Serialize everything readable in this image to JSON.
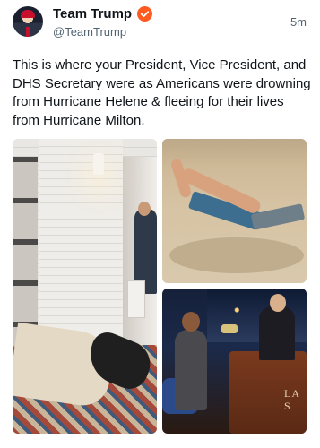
{
  "author": {
    "display_name": "Team Trump",
    "handle": "@TeamTrump",
    "verified_badge_color": "#ff5a1f"
  },
  "post": {
    "time_ago": "5m",
    "text": "This is where your President, Vice President, and DHS Secretary were as Americans were drowning from Hurricane Helene & fleeing for their lives from Hurricane Milton."
  },
  "media": {
    "count": 3,
    "items": [
      {
        "icon": "interior-photo"
      },
      {
        "icon": "beach-photo"
      },
      {
        "icon": "talk-show-photo"
      }
    ],
    "photo3_logo": "LA\nS"
  }
}
